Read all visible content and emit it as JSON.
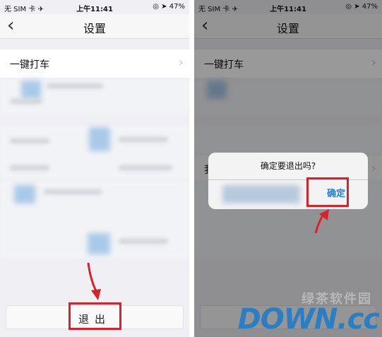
{
  "left": {
    "status": {
      "carrier": "无 SIM 卡 ✈",
      "time": "上午11:41",
      "battery": "◎ ➤ 47%"
    },
    "nav": {
      "title": "设置"
    },
    "rows": {
      "first_label": "一键打车"
    },
    "logout_label": "退出"
  },
  "right": {
    "status": {
      "carrier": "无 SIM 卡 ✈",
      "time": "上午11:41",
      "battery": "◎ ➤ 47%"
    },
    "nav": {
      "title": "设置"
    },
    "rows": {
      "first_label": "一键打车",
      "partial_label": "我"
    },
    "dialog": {
      "message": "确定要退出吗?",
      "confirm_label": "确定"
    }
  },
  "watermark": {
    "logo_text": "DOWN.cc",
    "logo_faint": "绿茶软件园"
  },
  "colors": {
    "highlight": "#d7232e",
    "link_blue": "#1a7fe0",
    "watermark_blue": "#2a7fc4",
    "watermark_red": "#d83a2c"
  }
}
